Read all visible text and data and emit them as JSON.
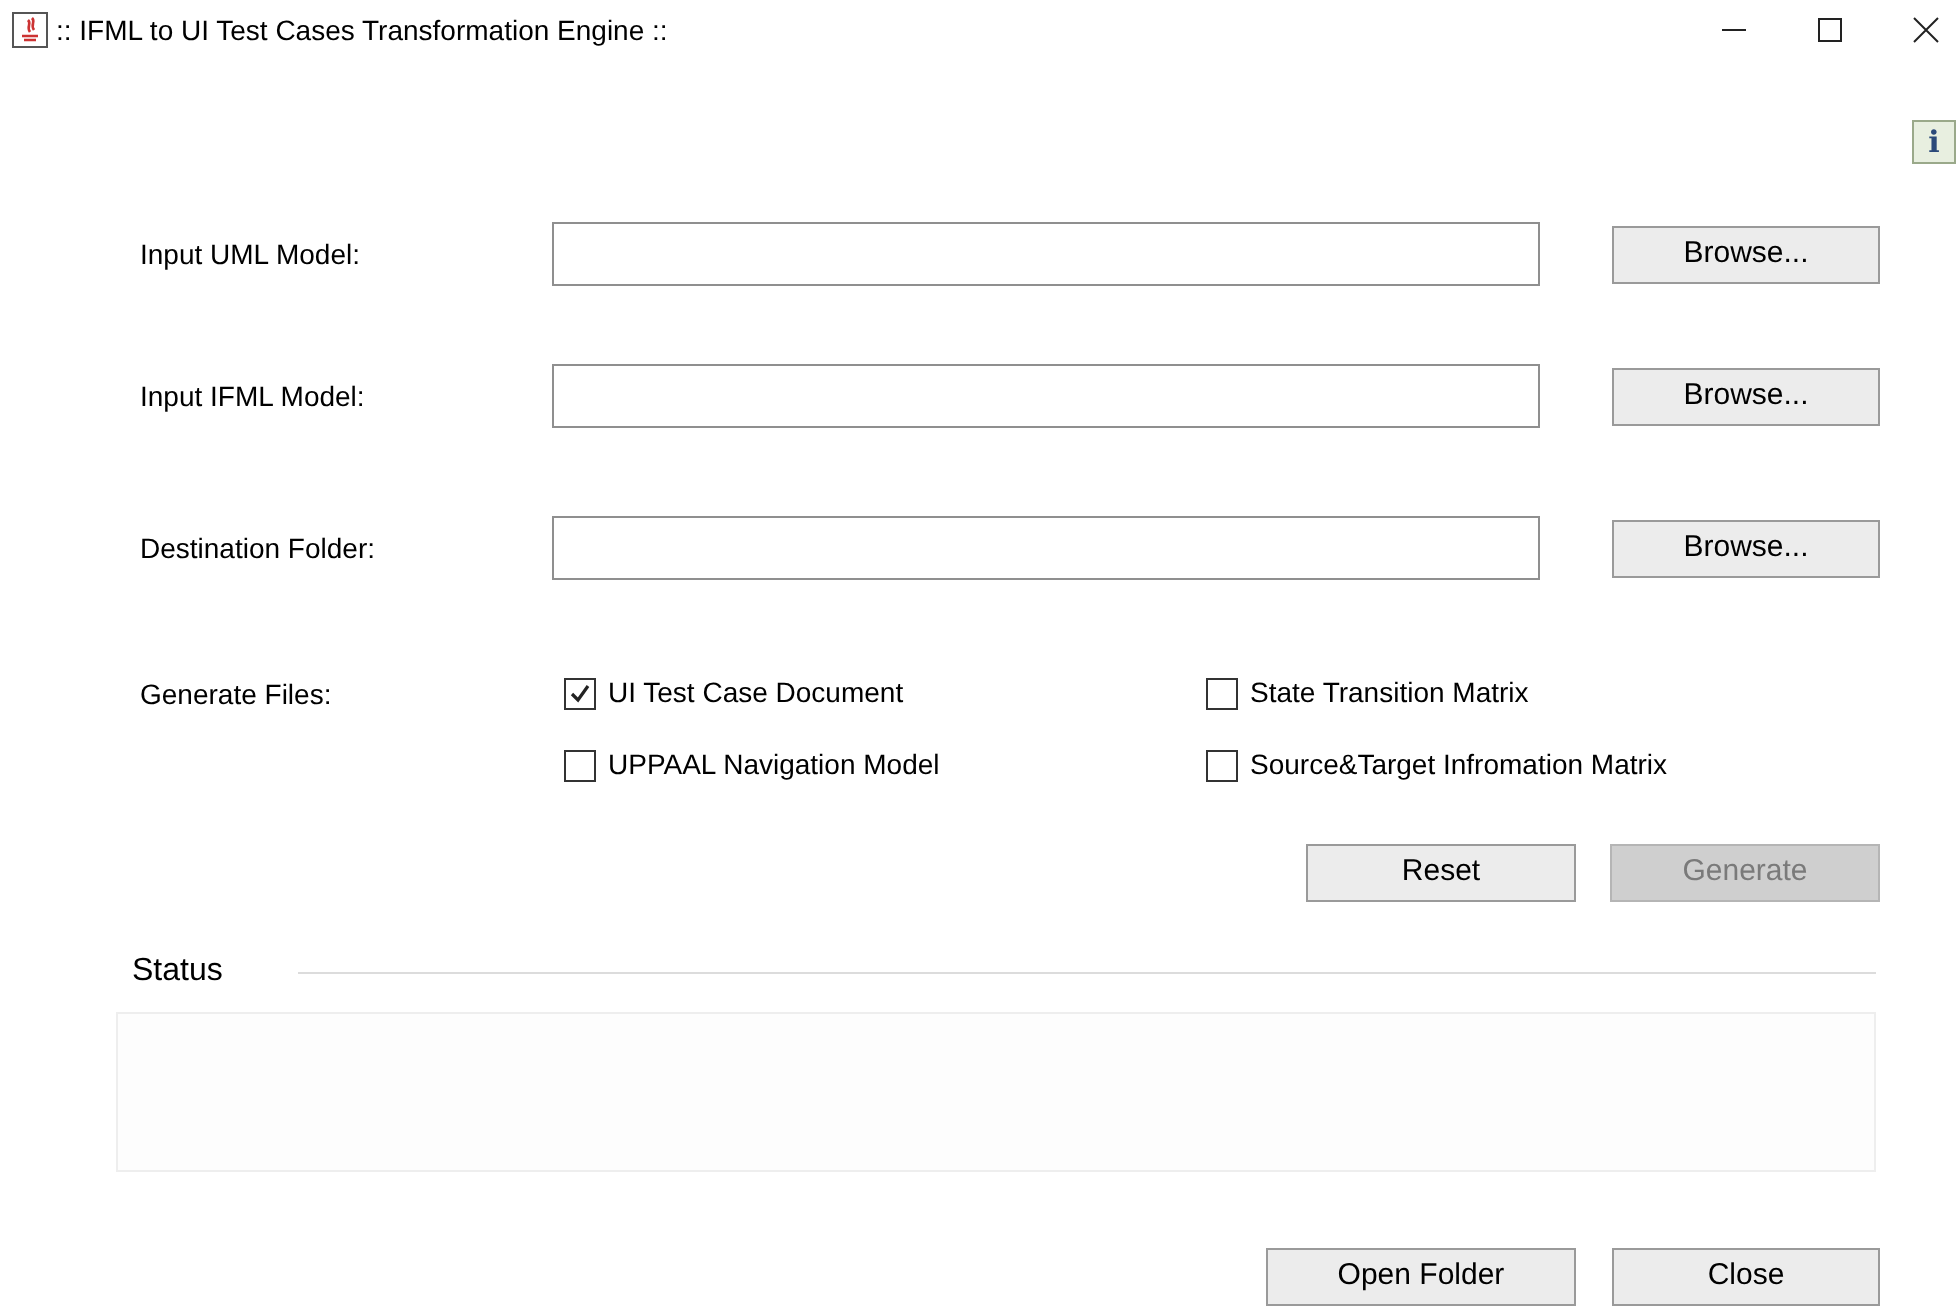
{
  "window": {
    "title": ":: IFML to UI Test Cases Transformation Engine ::"
  },
  "info_button": {
    "label": "i"
  },
  "inputs": [
    {
      "label": "Input UML Model:",
      "button": "Browse..."
    },
    {
      "label": "Input IFML Model:",
      "button": "Browse..."
    },
    {
      "label": "Destination Folder:",
      "button": "Browse..."
    }
  ],
  "generate_files": {
    "label": "Generate Files:",
    "options": [
      {
        "label": "UI Test Case Document",
        "checked": true
      },
      {
        "label": "State Transition Matrix",
        "checked": false
      },
      {
        "label": "UPPAAL Navigation Model",
        "checked": false
      },
      {
        "label": "Source&Target Infromation Matrix",
        "checked": false
      }
    ]
  },
  "actions": [
    {
      "label": "Reset",
      "disabled": false
    },
    {
      "label": "Generate",
      "disabled": true
    }
  ],
  "status": {
    "title": "Status"
  },
  "footer_buttons": [
    {
      "label": "Open Folder",
      "disabled": false
    },
    {
      "label": "Close",
      "disabled": false
    }
  ]
}
